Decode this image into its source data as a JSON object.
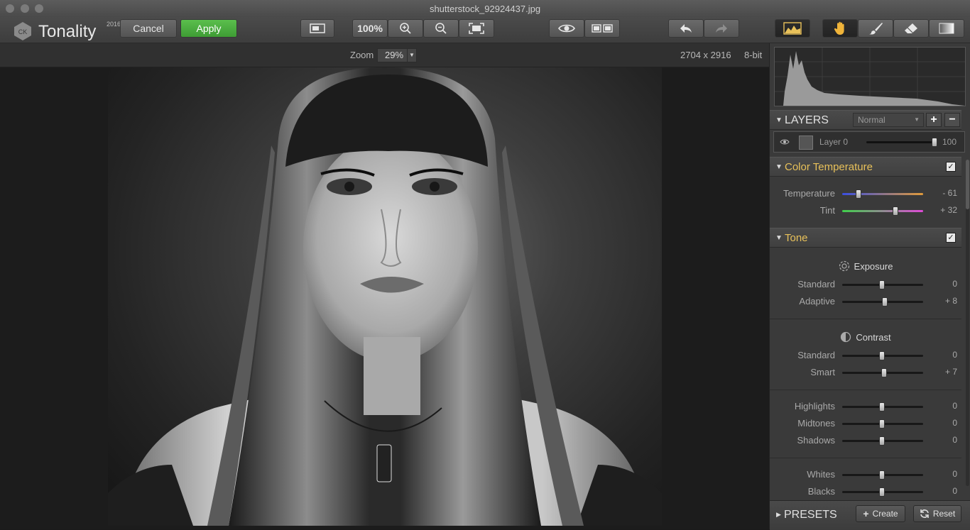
{
  "window": {
    "title": "shutterstock_92924437.jpg"
  },
  "app": {
    "name": "Tonality",
    "year": "2016",
    "logo_mark": "CK"
  },
  "toolbar": {
    "cancel_label": "Cancel",
    "apply_label": "Apply",
    "zoom_100_label": "100%",
    "icons": [
      "single-view-icon",
      "zoom-in-icon",
      "zoom-out-icon",
      "fit-screen-icon",
      "preview-eye-icon",
      "split-view-icon",
      "undo-icon",
      "redo-icon",
      "histogram-icon",
      "hand-tool-icon",
      "brush-tool-icon",
      "eraser-tool-icon",
      "gradient-tool-icon"
    ],
    "colors": {
      "apply": "#4aad3e",
      "accent": "#e8c15a"
    }
  },
  "infobar": {
    "zoom_label": "Zoom",
    "zoom_value": "29%",
    "dimensions": "2704 x 2916",
    "bit_depth": "8-bit"
  },
  "layers": {
    "title": "LAYERS",
    "blend_mode": "Normal",
    "layer_name": "Layer 0",
    "opacity": "100"
  },
  "color_temperature": {
    "title": "Color Temperature",
    "temperature_label": "Temperature",
    "temperature_value": "- 61",
    "tint_label": "Tint",
    "tint_value": "+ 32"
  },
  "tone": {
    "title": "Tone",
    "exposure_title": "Exposure",
    "exposure_standard_label": "Standard",
    "exposure_standard_value": "0",
    "exposure_adaptive_label": "Adaptive",
    "exposure_adaptive_value": "+ 8",
    "contrast_title": "Contrast",
    "contrast_standard_label": "Standard",
    "contrast_standard_value": "0",
    "contrast_smart_label": "Smart",
    "contrast_smart_value": "+ 7",
    "highlights_label": "Highlights",
    "highlights_value": "0",
    "midtones_label": "Midtones",
    "midtones_value": "0",
    "shadows_label": "Shadows",
    "shadows_value": "0",
    "whites_label": "Whites",
    "whites_value": "0",
    "blacks_label": "Blacks",
    "blacks_value": "0"
  },
  "presets": {
    "title": "PRESETS",
    "create_label": "Create",
    "reset_label": "Reset"
  }
}
